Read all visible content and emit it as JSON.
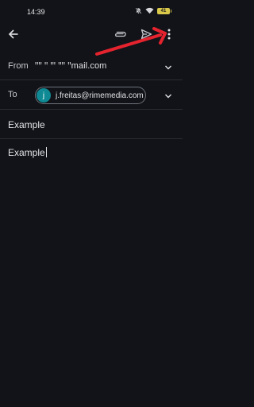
{
  "status_bar": {
    "time": "14:39",
    "battery": "41",
    "icons": [
      "mute-icon",
      "wifi-icon",
      "battery-icon"
    ]
  },
  "toolbar": {
    "back_icon": "back-arrow-icon",
    "attach_icon": "paperclip-icon",
    "send_icon": "send-icon",
    "more_icon": "more-vert-icon"
  },
  "annotation": {
    "color": "#e5232e",
    "points_to": "more-vert-icon"
  },
  "compose": {
    "from_label": "From",
    "from_value": "ꞌꞌꞌꞌ  ꞌꞌ ꞌꞌꞌ  ꞌꞌꞌꞌ  ꞌꞌmail.com",
    "to_label": "To",
    "to_chip": {
      "avatar_letter": "j",
      "email": "j.freitas@rimemedia.com",
      "avatar_color": "#0f8a94"
    },
    "subject": "Example",
    "body": "Example"
  },
  "colors": {
    "background": "#111318",
    "text": "#e3e3e6",
    "divider": "#2a2c33"
  }
}
